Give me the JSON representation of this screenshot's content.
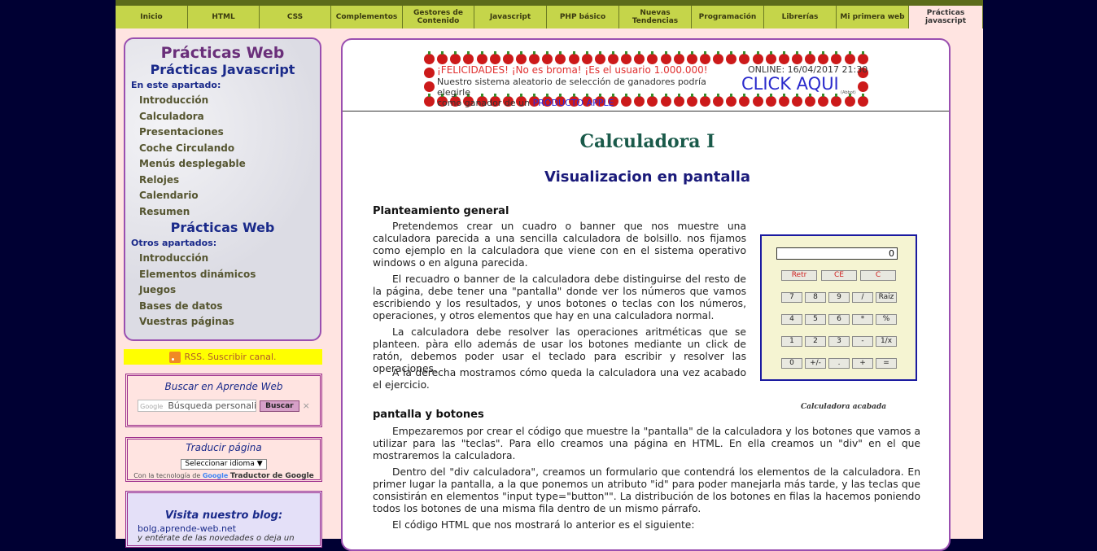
{
  "nav": {
    "items": [
      "Inicio",
      "HTML",
      "CSS",
      "Complementos",
      "Gestores de\nContenido",
      "Javascript",
      "PHP básico",
      "Nuevas\nTendencias",
      "Programación",
      "Librerías",
      "Mi primera web",
      "Prácticas\njavascript"
    ],
    "active_index": 11
  },
  "sidebar": {
    "title": "Prácticas Web",
    "section1_title": "Prácticas Javascript",
    "section1_caption": "En este apartado:",
    "section1_links": [
      "Introducción",
      "Calculadora",
      "Presentaciones",
      "Coche Circulando",
      "Menús desplegable",
      "Relojes",
      "Calendario",
      "Resumen"
    ],
    "section2_title": "Prácticas Web",
    "section2_caption": "Otros apartados:",
    "section2_links": [
      "Introducción",
      "Elementos dinámicos",
      "Juegos",
      "Bases de datos",
      "Vuestras páginas"
    ]
  },
  "rss": {
    "label": "RSS. Suscribir canal."
  },
  "search_widget": {
    "title": "Buscar en Aprende Web",
    "google_label": "Google",
    "placeholder": "Búsqueda personali",
    "button": "Buscar",
    "clear": "×"
  },
  "translate_widget": {
    "title": "Traducir página",
    "select": "Seleccionar idioma ▼",
    "powered_prefix": "Con la tecnología de",
    "google": "Google",
    "powered_suffix": "Traductor de Google"
  },
  "blog_widget": {
    "title": "Visita nuestro blog:",
    "link": "bolg.aprende-web.net",
    "subtitle": "y entérate de las novedades o deja un"
  },
  "banner": {
    "headline": "¡FELICIDADES! ¡No es broma! ¡Es el usuario 1.000.000!",
    "text1": "Nuestro sistema aleatorio de selección de ganadores podría elegirle",
    "text2": "como ganador de un ",
    "product": "PRODUCTO APPLE",
    "online": "ONLINE: 16/04/2017 21:30",
    "click": "CLICK AQUI",
    "small": "(Abbot)"
  },
  "article": {
    "title": "Calculadora I",
    "subtitle": "Visualizacion en pantalla",
    "h_planteamiento": "Planteamiento general",
    "p1": "Pretendemos crear un cuadro o banner que nos muestre una calculadora parecida a una sencilla calculadora de bolsillo. nos fijamos como ejemplo en la calculadora que viene con en el sistema operativo windows o en alguna parecida.",
    "p2": "El recuadro o banner de la calculadora debe distinguirse del resto de la página, debe tener una \"pantalla\" donde ver los números que vamos escribiendo y los resultados, y unos botones o teclas con los números, operaciones, y otros elementos que hay en una calculadora normal.",
    "p3": "La calculadora debe resolver las operaciones aritméticas que se planteen. pàra ello además de usar los botones mediante un click de ratón, debemos poder usar el teclado para escribir y resolver las operaciones.",
    "p4": "A la derecha mostramos cómo queda la calculadora una vez acabado el ejercicio.",
    "h_pantalla": "pantalla y botones",
    "p5": "Empezaremos por crear el código que muestre la \"pantalla\" de la calculadora y los botones que vamos a utilizar para las \"teclas\". Para ello creamos una página en HTML. En ella creamos un \"div\" en el que mostraremos la calculadora.",
    "p6": "Dentro del \"div calculadora\", creamos un formulario que contendrá los elementos de la calculadora. En primer lugar la pantalla, a la que ponemos un atributo \"id\" para poder manejarla más tarde, y las teclas que consistirán en elementos \"input type=\"button\"\". La distribución de los botones en filas la hacemos poniendo todos los botones de una misma fila dentro de un mismo párrafo.",
    "p7": "El código HTML que nos mostrará lo anterior es el siguiente:",
    "caption": "Calculadora acabada"
  },
  "calculator": {
    "display": "0",
    "row0": [
      "Retr",
      "CE",
      "C"
    ],
    "row1": [
      "7",
      "8",
      "9",
      "/",
      "Raiz"
    ],
    "row2": [
      "4",
      "5",
      "6",
      "*",
      "%"
    ],
    "row3": [
      "1",
      "2",
      "3",
      "-",
      "1/x"
    ],
    "row4": [
      "0",
      "+/-",
      ".",
      "+",
      "="
    ]
  }
}
